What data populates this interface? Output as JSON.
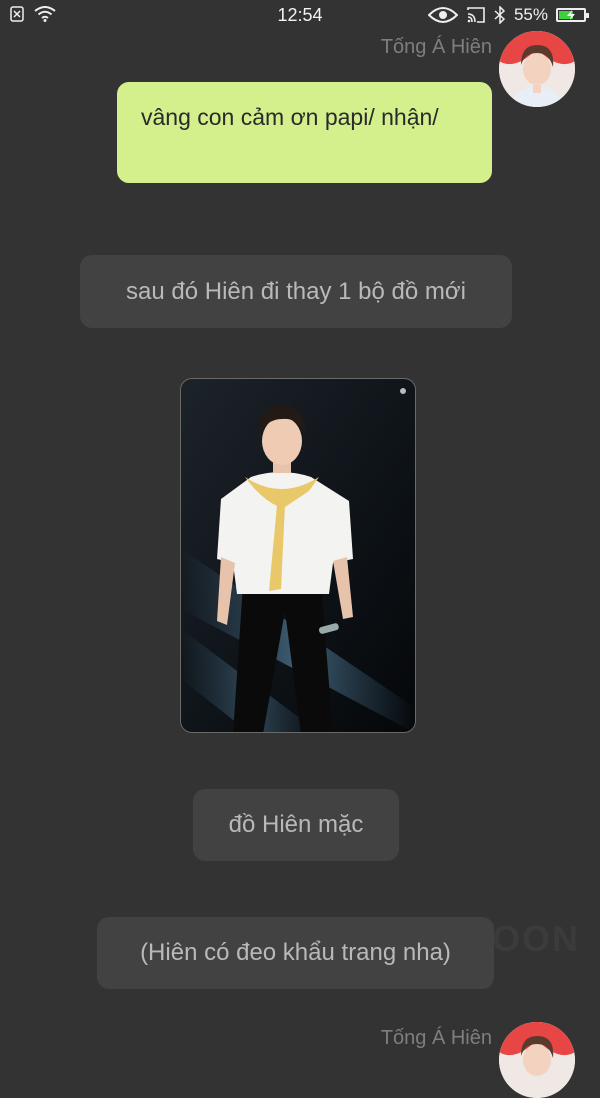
{
  "status_bar": {
    "time": "12:54",
    "battery_text": "55%",
    "battery_level": 0.55,
    "icons": [
      "sim-off-icon",
      "wifi-icon",
      "eye-icon",
      "cast-icon",
      "bluetooth-icon",
      "battery-charging-icon"
    ]
  },
  "chat": {
    "messages": [
      {
        "sender": "Tống Á Hiên",
        "text": "vâng con cảm ơn papi/ nhận/"
      },
      {
        "text": "sau đó Hiên đi thay 1 bộ đồ mới"
      },
      {
        "image": "photo of Hiên on stage in white shirt with yellow sweater over shoulders"
      },
      {
        "text": "đồ Hiên mặc"
      },
      {
        "text": "(Hiên có đeo khẩu trang nha)"
      },
      {
        "sender": "Tống Á Hiên"
      }
    ]
  },
  "watermark": "OON",
  "colors": {
    "background": "#333333",
    "green_bubble": "#d3f08c",
    "gray_bubble": "#424242"
  }
}
